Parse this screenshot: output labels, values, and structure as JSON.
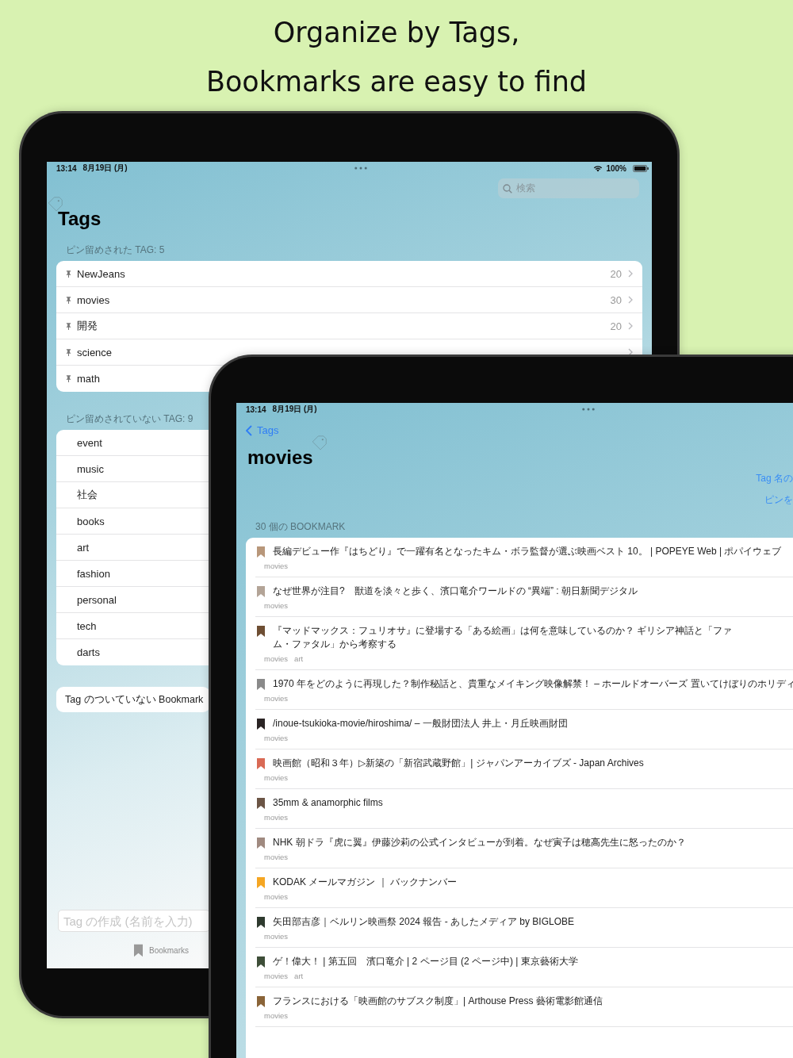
{
  "headline": [
    "Organize by Tags,",
    "Bookmarks are easy to find"
  ],
  "tags_screen": {
    "status_bar": {
      "time": "13:14",
      "date": "8月19日 (月)",
      "battery": "100%"
    },
    "search": {
      "placeholder": "検索"
    },
    "title": "Tags",
    "pinned": {
      "header": "ピン留めされた TAG: 5",
      "items": [
        {
          "name": "NewJeans",
          "count": "20",
          "disclosure": true
        },
        {
          "name": "movies",
          "count": "30",
          "disclosure": true
        },
        {
          "name": "開発",
          "count": "20",
          "disclosure": true
        },
        {
          "name": "science",
          "disclosure": true
        },
        {
          "name": "math",
          "disclosure": false
        }
      ]
    },
    "unpinned": {
      "header": "ピン留めされていない TAG: 9",
      "items": [
        {
          "name": "event"
        },
        {
          "name": "music"
        },
        {
          "name": "社会"
        },
        {
          "name": "books"
        },
        {
          "name": "art"
        },
        {
          "name": "fashion"
        },
        {
          "name": "personal"
        },
        {
          "name": "tech"
        },
        {
          "name": "darts"
        }
      ]
    },
    "untagged_link": "Tag のついていない Bookmark",
    "new_tag_field": {
      "placeholder": "Tag の作成 (名前を入力)"
    },
    "tab_bar": [
      {
        "label": "Bookmarks",
        "selected": false
      }
    ]
  },
  "movies_screen": {
    "status_bar": {
      "time": "13:14",
      "date": "8月19日 (月)"
    },
    "back": "Tags",
    "title": "movies",
    "actions": [
      "Tag 名の",
      "ピンを"
    ],
    "section_header": "30 個の BOOKMARK",
    "bookmarks": [
      {
        "title": "長編デビュー作『はちどり』で一躍有名となったキム・ボラ監督が選ぶ映画ベスト 10。 | POPEYE Web | ポパイウェブ",
        "color": "#b8977a",
        "tags": [
          "movies"
        ]
      },
      {
        "title": "なぜ世界が注目?　獣道を淡々と歩く、濱口竜介ワールドの “異端” : 朝日新聞デジタル",
        "color": "#b3a497",
        "tags": [
          "movies"
        ]
      },
      {
        "title": "『マッドマックス：フュリオサ』に登場する「ある絵画」は何を意味しているのか？ ギリシア神話と「ファム・ファタル」から考察する",
        "color": "#6e4e33",
        "tags": [
          "movies",
          "art"
        ]
      },
      {
        "title": "1970 年をどのように再現した？制作秘話と、貴重なメイキング映像解禁！ – ホールドオーバーズ 置いてけぼりのホリディ",
        "color": "#8a8a8a",
        "tags": [
          "movies"
        ]
      },
      {
        "title": "/inoue-tsukioka-movie/hiroshima/ – 一般財団法人 井上・月丘映画財団",
        "color": "#2a2424",
        "tags": [
          "movies"
        ]
      },
      {
        "title": "映画館（昭和３年）▷新築の「新宿武蔵野館」| ジャパンアーカイブズ - Japan Archives",
        "color": "#d96a55",
        "tags": [
          "movies"
        ]
      },
      {
        "title": "35mm & anamorphic films",
        "color": "#6b5545",
        "tags": [
          "movies"
        ]
      },
      {
        "title": "NHK 朝ドラ『虎に翼』伊藤沙莉の公式インタビューが到着。なぜ寅子は穂高先生に怒ったのか？",
        "color": "#a08a80",
        "tags": [
          "movies"
        ]
      },
      {
        "title": "KODAK メールマガジン ｜ バックナンバー",
        "color": "#f5a623",
        "tags": [
          "movies"
        ]
      },
      {
        "title": "矢田部吉彦｜ベルリン映画祭 2024 報告 - あしたメディア by BIGLOBE",
        "color": "#2e3a2e",
        "tags": [
          "movies"
        ]
      },
      {
        "title": "ゲ！偉大！ | 第五回　濱口竜介 | 2 ページ目 (2 ページ中) | 東京藝術大学",
        "color": "#3e4e38",
        "tags": [
          "movies",
          "art"
        ]
      },
      {
        "title": "フランスにおける「映画館のサブスク制度」| Arthouse Press 藝術電影館通信",
        "color": "#8a6438",
        "tags": [
          "movies"
        ]
      }
    ]
  }
}
